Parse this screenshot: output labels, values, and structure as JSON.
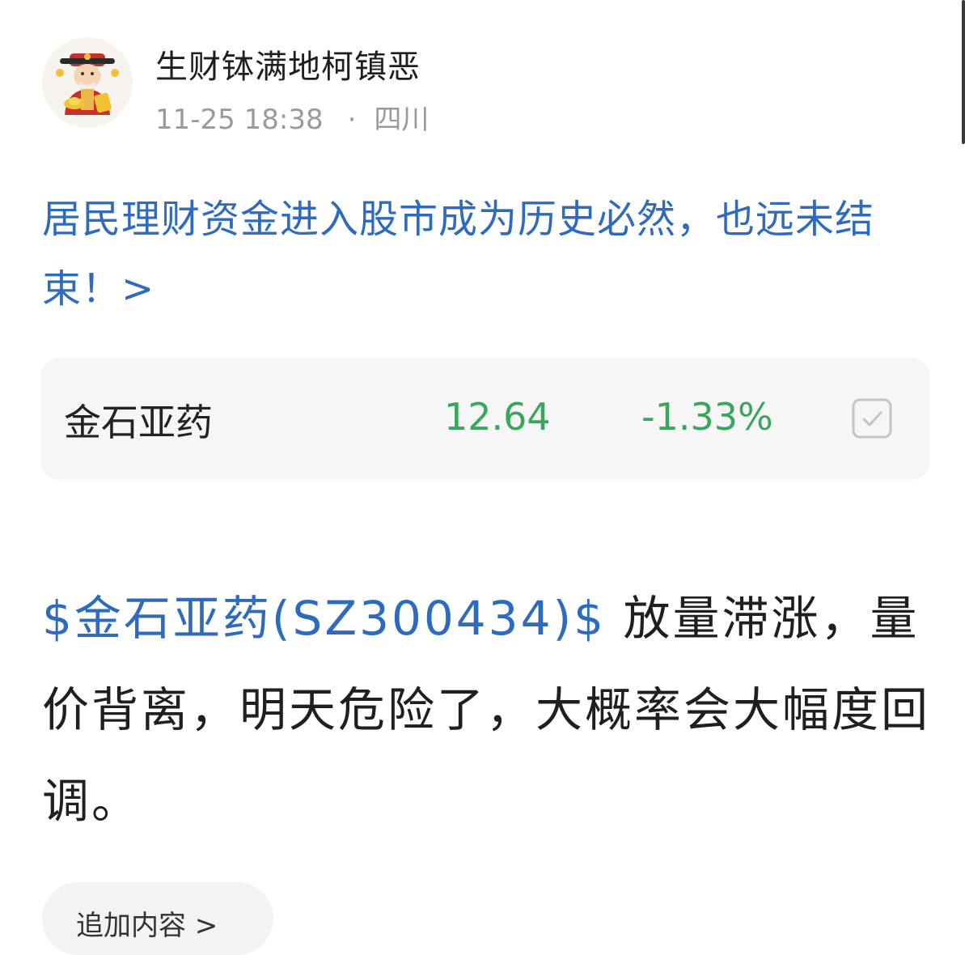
{
  "post": {
    "author": "生财钵满地柯镇恶",
    "time": "11-25 18:38",
    "separator": "·",
    "location": "四川",
    "title": "居民理财资金进入股市成为历史必然，也远未结束！>",
    "stock_card": {
      "name": "金石亚药",
      "price": "12.64",
      "change": "-1.33%"
    },
    "body": {
      "stock_tag": "$金石亚药(SZ300434)$",
      "text": " 放量滞涨，量价背离，明天危险了，大概率会大幅度回调。"
    },
    "bottom_chip": "追加内容 >"
  },
  "colors": {
    "link_blue": "#2e6bbf",
    "down_green": "#3aa65c",
    "meta_gray": "#9a9a9a",
    "card_bg": "#f6f6f7"
  },
  "icons": {
    "avatar": "god-of-wealth-avatar",
    "watch": "checkbox-checked-icon"
  }
}
